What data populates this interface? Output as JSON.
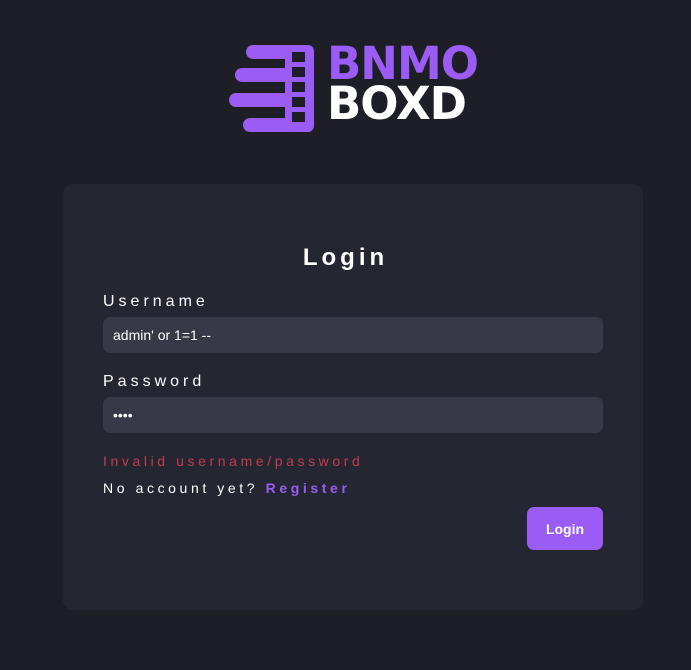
{
  "brand": {
    "line1": "BNMO",
    "line2": "BOXD",
    "logo_icon": "film-reel-speed-icon",
    "accent_color": "#9a5cf5"
  },
  "form": {
    "title": "Login",
    "username_label": "Username",
    "username_value": "admin' or 1=1 --",
    "password_label": "Password",
    "password_value": "test",
    "error_message": "Invalid username/password",
    "no_account_text": "No account yet?",
    "register_link": "Register",
    "login_button": "Login"
  },
  "colors": {
    "background": "#1e1f26",
    "card": "#242631",
    "input": "#373a46",
    "error": "#c53a52"
  }
}
